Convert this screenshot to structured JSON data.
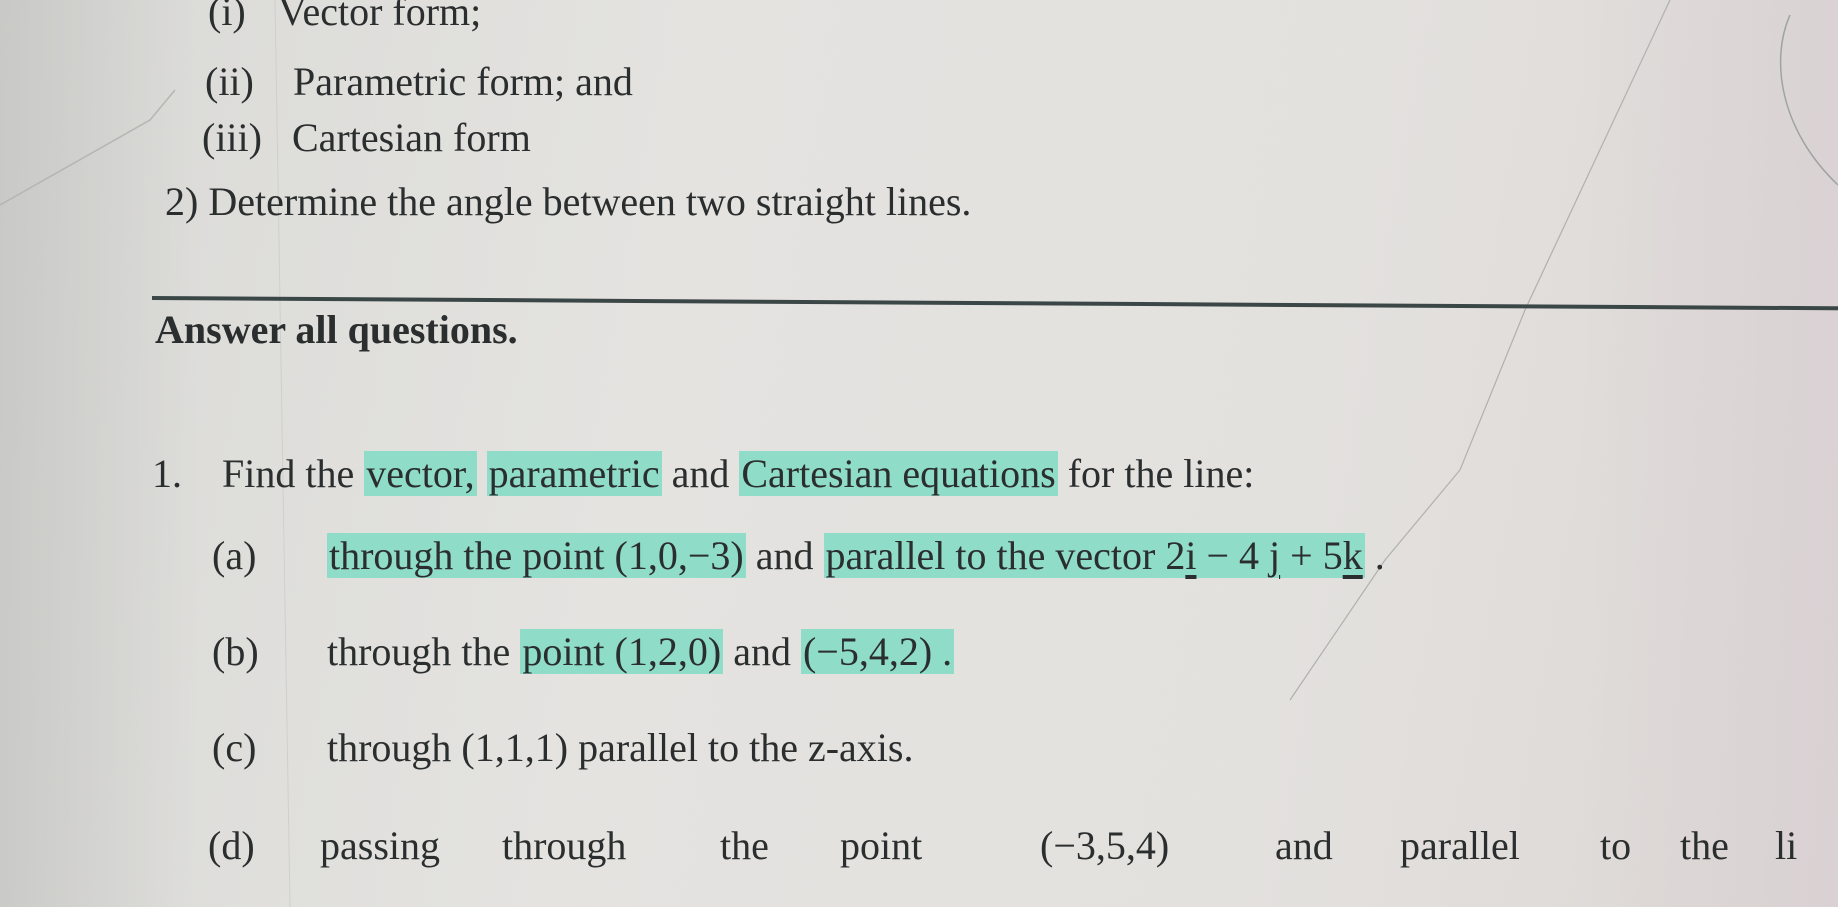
{
  "document": {
    "sub_items": [
      {
        "marker": "(i)",
        "text": "Vector form;"
      },
      {
        "marker": "(ii)",
        "text": "Parametric form; and"
      },
      {
        "marker": "(iii)",
        "text": "Cartesian form"
      }
    ],
    "objective_2": "2) Determine the angle between two straight lines.",
    "instruction": "Answer all questions.",
    "question_1": {
      "number": "1.",
      "prefix": "Find the ",
      "hl_vector": "vector,",
      "hl_parametric": "parametric",
      "mid": " and ",
      "hl_cartesian": "Cartesian equations",
      "suffix": " for the line:"
    },
    "parts": {
      "a": {
        "marker": "(a)",
        "hl_text": "through the point (1,0,−3)",
        "mid": " and ",
        "hl_text2": "parallel to the vector ",
        "vec_2": "2",
        "vec_i": "i",
        "vec_minus4": " − 4",
        "vec_j": "j",
        "vec_plus5": " + 5",
        "vec_k": "k",
        "end": " ."
      },
      "b": {
        "marker": "(b)",
        "pre": "through the ",
        "hl_text": "point (1,2,0)",
        "mid": " and ",
        "hl_text2": "(−5,4,2) ."
      },
      "c": {
        "marker": "(c)",
        "text": "through (1,1,1) parallel to the z-axis."
      },
      "d": {
        "marker": "(d)",
        "words": [
          "passing",
          "through",
          "the",
          "point",
          "(−3,5,4)",
          "and",
          "parallel",
          "to",
          "the",
          "li"
        ]
      }
    }
  },
  "colors": {
    "highlight": "#8fdcc8",
    "text": "#2b2e2e",
    "rule": "#3a4746"
  }
}
